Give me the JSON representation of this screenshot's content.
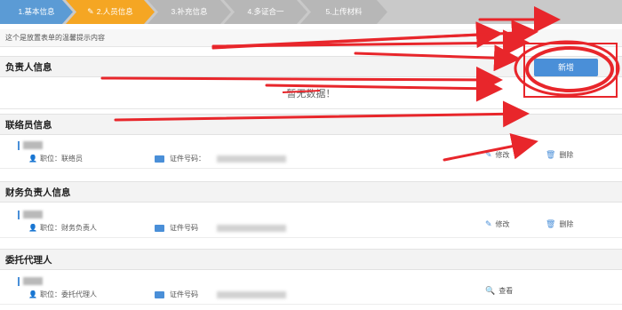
{
  "steps": [
    {
      "label": "1.基本信息",
      "state": "done"
    },
    {
      "label": "2.人员信息",
      "state": "active"
    },
    {
      "label": "3.补充信息",
      "state": "todo"
    },
    {
      "label": "4.多证合一",
      "state": "todo"
    },
    {
      "label": "5.上传材料",
      "state": "todo"
    }
  ],
  "tip": "这个是放置表单的温馨提示内容",
  "sections": {
    "principal": {
      "title": "负责人信息",
      "add_label": "新增",
      "empty_text": "暂无数据！"
    },
    "liaison": {
      "title": "联络员信息",
      "role": "职位：联络员",
      "id_label": "证件号码：",
      "edit_label": "修改",
      "delete_label": "删除"
    },
    "finance": {
      "title": "财务负责人信息",
      "role": "职位：财务负责人",
      "id_label": "证件号码",
      "edit_label": "修改",
      "delete_label": "删除"
    },
    "agent": {
      "title": "委托代理人",
      "role": "职位：委托代理人",
      "id_label": "证件号码",
      "view_label": "查看"
    }
  },
  "colors": {
    "accent": "#4a8fd8",
    "active_step": "#f5a623",
    "annotation": "#e8262b"
  }
}
